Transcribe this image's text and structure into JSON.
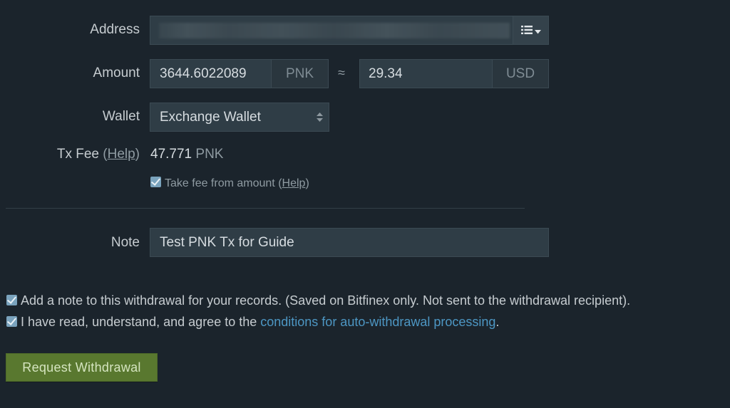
{
  "form": {
    "address": {
      "label": "Address",
      "value_obscured": true,
      "address_book_icon": "list-dropdown-icon"
    },
    "amount": {
      "label": "Amount",
      "value": "3644.6022089",
      "currency": "PNK",
      "approx_symbol": "≈",
      "usd_value": "29.34",
      "usd_currency": "USD"
    },
    "wallet": {
      "label": "Wallet",
      "selected": "Exchange Wallet"
    },
    "tx_fee": {
      "label": "Tx Fee",
      "help_prefix": "(",
      "help_label": "Help",
      "help_suffix": ")",
      "value": "47.771",
      "unit": "PNK"
    },
    "take_fee": {
      "checked": true,
      "label": "Take fee from amount",
      "help_prefix": " (",
      "help_label": "Help",
      "help_suffix": ")"
    },
    "note": {
      "label": "Note",
      "value": "Test PNK Tx for Guide"
    }
  },
  "agreements": {
    "add_note": {
      "checked": true,
      "label": "Add a note to this withdrawal for your records. (Saved on Bitfinex only. Not sent to the withdrawal recipient)."
    },
    "conditions": {
      "checked": true,
      "prefix": "I have read, understand, and agree to the ",
      "link_label": "conditions for auto-withdrawal processing",
      "suffix": "."
    }
  },
  "actions": {
    "submit_label": "Request Withdrawal"
  },
  "colors": {
    "background": "#1b242c",
    "input_bg": "#2f3d46",
    "link": "#4d97c4",
    "checkbox": "#7aa3bd",
    "submit_button": "#59782f"
  }
}
